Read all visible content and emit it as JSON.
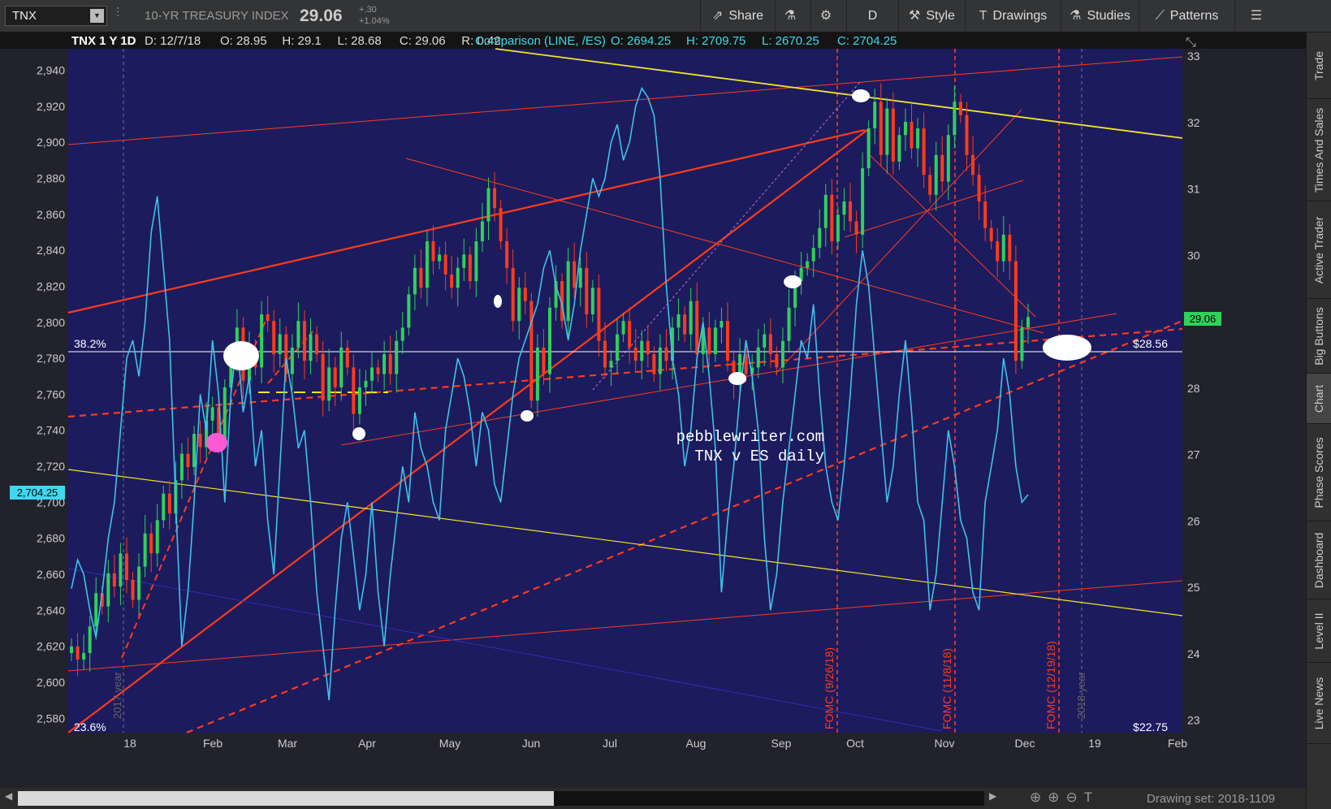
{
  "toolbar": {
    "symbol": "TNX",
    "description": "10-YR TREASURY INDEX",
    "last": "29.06",
    "change": "+.30",
    "change_pct": "+1.04%",
    "buttons": [
      {
        "label": "Share",
        "icon": "share-icon",
        "glyph": "⇗"
      },
      {
        "label": "",
        "icon": "flask-icon",
        "glyph": "⚗"
      },
      {
        "label": "",
        "icon": "gear-icon",
        "glyph": "⚙"
      },
      {
        "label": "D",
        "icon": "",
        "glyph": ""
      },
      {
        "label": "Style",
        "icon": "style-icon",
        "glyph": "⚒"
      },
      {
        "label": "Drawings",
        "icon": "drawings-icon",
        "glyph": "T"
      },
      {
        "label": "Studies",
        "icon": "studies-icon",
        "glyph": "⚗"
      },
      {
        "label": "Patterns",
        "icon": "patterns-icon",
        "glyph": "⟋"
      },
      {
        "label": "",
        "icon": "menu-icon",
        "glyph": "☰"
      }
    ]
  },
  "sidebar_tabs": [
    "Trade",
    "Times And Sales",
    "Active Trader",
    "Big Buttons",
    "Chart",
    "Phase Scores",
    "Dashboard",
    "Level II",
    "Live News"
  ],
  "header": {
    "title": "TNX 1 Y 1D",
    "fields": [
      "D: 12/7/18",
      "O: 28.95",
      "H: 29.1",
      "L: 28.68",
      "C: 29.06",
      "R: 0.42"
    ],
    "comparison": "Comparison (LINE, /ES)",
    "comp_fields": [
      "O: 2694.25",
      "H: 2709.75",
      "L: 2670.25",
      "C: 2704.25"
    ]
  },
  "chart_data": {
    "type": "line",
    "left_axis": {
      "ticks": [
        "2,940",
        "2,920",
        "2,900",
        "2,880",
        "2,860",
        "2,840",
        "2,820",
        "2,800",
        "2,780",
        "2,760",
        "2,740",
        "2,720",
        "2,700",
        "2,680",
        "2,660",
        "2,640",
        "2,620",
        "2,600",
        "2,580"
      ],
      "range": [
        2572,
        2952
      ],
      "current_label": "2,704.25"
    },
    "right_axis": {
      "ticks": [
        "33",
        "32",
        "31",
        "30",
        "29",
        "28",
        "27",
        "26",
        "25",
        "24",
        "23"
      ],
      "range": [
        22.8,
        33.1
      ],
      "current_label": "29.06"
    },
    "x_ticks": [
      "18",
      "Feb",
      "Mar",
      "Apr",
      "May",
      "Jun",
      "Jul",
      "Aug",
      "Sep",
      "Oct",
      "Nov",
      "Dec",
      "19",
      "Feb"
    ],
    "annotations": {
      "watermark_line1": "pebblewriter.com",
      "watermark_line2": "TNX v ES daily",
      "fib_382": "38.2%",
      "fib_236": "23.6%",
      "level_2856": "$28.56",
      "level_2275": "$22.75",
      "fomc": [
        "FOMC (9/26/18)",
        "FOMC (11/8/18)",
        "FOMC (12/19/18)"
      ],
      "year_2017": "2017 year",
      "year_2018": "2018 year"
    },
    "series": [
      {
        "name": "TNX",
        "color": "#ff3b1a",
        "values": [
          24.1,
          23.9,
          24.0,
          24.4,
          24.9,
          24.7,
          25.2,
          25.0,
          25.5,
          25.1,
          24.8,
          25.3,
          25.8,
          25.5,
          26.0,
          26.4,
          26.1,
          26.6,
          27.0,
          26.8,
          27.3,
          27.1,
          27.5,
          27.7,
          27.2,
          28.0,
          28.4,
          28.9,
          28.1,
          28.6,
          28.3,
          29.1,
          29.0,
          28.5,
          28.8,
          28.2,
          28.6,
          29.0,
          28.4,
          28.8,
          28.5,
          27.8,
          28.3,
          28.0,
          28.6,
          28.3,
          27.6,
          28.0,
          28.1,
          28.3,
          28.2,
          28.5,
          28.2,
          28.7,
          28.9,
          29.4,
          29.8,
          29.5,
          30.2,
          29.9,
          30.0,
          29.7,
          29.5,
          29.8,
          30.0,
          29.6,
          30.2,
          30.5,
          31.0,
          30.7,
          30.2,
          29.8,
          29.0,
          29.5,
          29.3,
          27.8,
          28.6,
          28.2,
          29.2,
          29.6,
          29.0,
          29.9,
          29.5,
          29.8,
          29.1,
          29.5,
          28.7,
          28.3,
          28.4,
          28.8,
          29.0,
          28.6,
          28.4,
          28.7,
          28.5,
          28.2,
          28.6,
          28.4,
          28.9,
          29.1,
          28.8,
          29.3,
          28.5,
          28.9,
          28.5,
          28.9,
          29.0,
          28.4,
          28.1,
          28.5,
          28.2,
          28.3,
          28.6,
          28.8,
          28.5,
          28.3,
          28.7,
          29.2,
          29.6,
          29.8,
          29.9,
          30.1,
          30.4,
          30.9,
          30.2,
          30.6,
          30.8,
          30.5,
          30.3,
          31.3,
          31.9,
          32.3,
          31.5,
          32.2,
          31.4,
          31.8,
          32.0,
          31.6,
          31.9,
          31.2,
          30.9,
          31.5,
          31.1,
          31.8,
          32.3,
          32.1,
          31.5,
          31.2,
          30.8,
          30.4,
          30.2,
          29.9,
          30.3,
          29.9,
          28.4,
          28.9,
          29.06
        ]
      },
      {
        "name": "/ES",
        "color": "#3fc3e8",
        "values": [
          2652,
          2668,
          2660,
          2640,
          2625,
          2650,
          2680,
          2700,
          2740,
          2780,
          2790,
          2770,
          2800,
          2850,
          2870,
          2830,
          2790,
          2700,
          2620,
          2650,
          2700,
          2760,
          2740,
          2790,
          2760,
          2700,
          2760,
          2790,
          2750,
          2770,
          2720,
          2740,
          2690,
          2660,
          2720,
          2780,
          2760,
          2730,
          2740,
          2700,
          2650,
          2620,
          2590,
          2640,
          2680,
          2700,
          2670,
          2640,
          2660,
          2700,
          2650,
          2620,
          2660,
          2690,
          2720,
          2700,
          2750,
          2730,
          2720,
          2700,
          2690,
          2740,
          2760,
          2780,
          2770,
          2750,
          2720,
          2750,
          2740,
          2710,
          2700,
          2730,
          2760,
          2780,
          2790,
          2800,
          2810,
          2830,
          2840,
          2820,
          2810,
          2790,
          2810,
          2840,
          2860,
          2880,
          2870,
          2880,
          2900,
          2910,
          2890,
          2900,
          2920,
          2930,
          2925,
          2915,
          2880,
          2820,
          2780,
          2760,
          2720,
          2740,
          2780,
          2800,
          2770,
          2730,
          2650,
          2690,
          2720,
          2760,
          2790,
          2770,
          2740,
          2680,
          2640,
          2660,
          2700,
          2730,
          2760,
          2790,
          2780,
          2810,
          2760,
          2720,
          2700,
          2690,
          2720,
          2760,
          2810,
          2840,
          2820,
          2780,
          2740,
          2700,
          2720,
          2760,
          2790,
          2750,
          2700,
          2690,
          2640,
          2660,
          2700,
          2740,
          2720,
          2690,
          2680,
          2650,
          2640,
          2700,
          2720,
          2740,
          2780,
          2760,
          2720,
          2700,
          2704.25
        ]
      }
    ],
    "grid": false,
    "legend": "none"
  },
  "scrollbar": {
    "drawing_set": "Drawing set: 2018-1109"
  }
}
